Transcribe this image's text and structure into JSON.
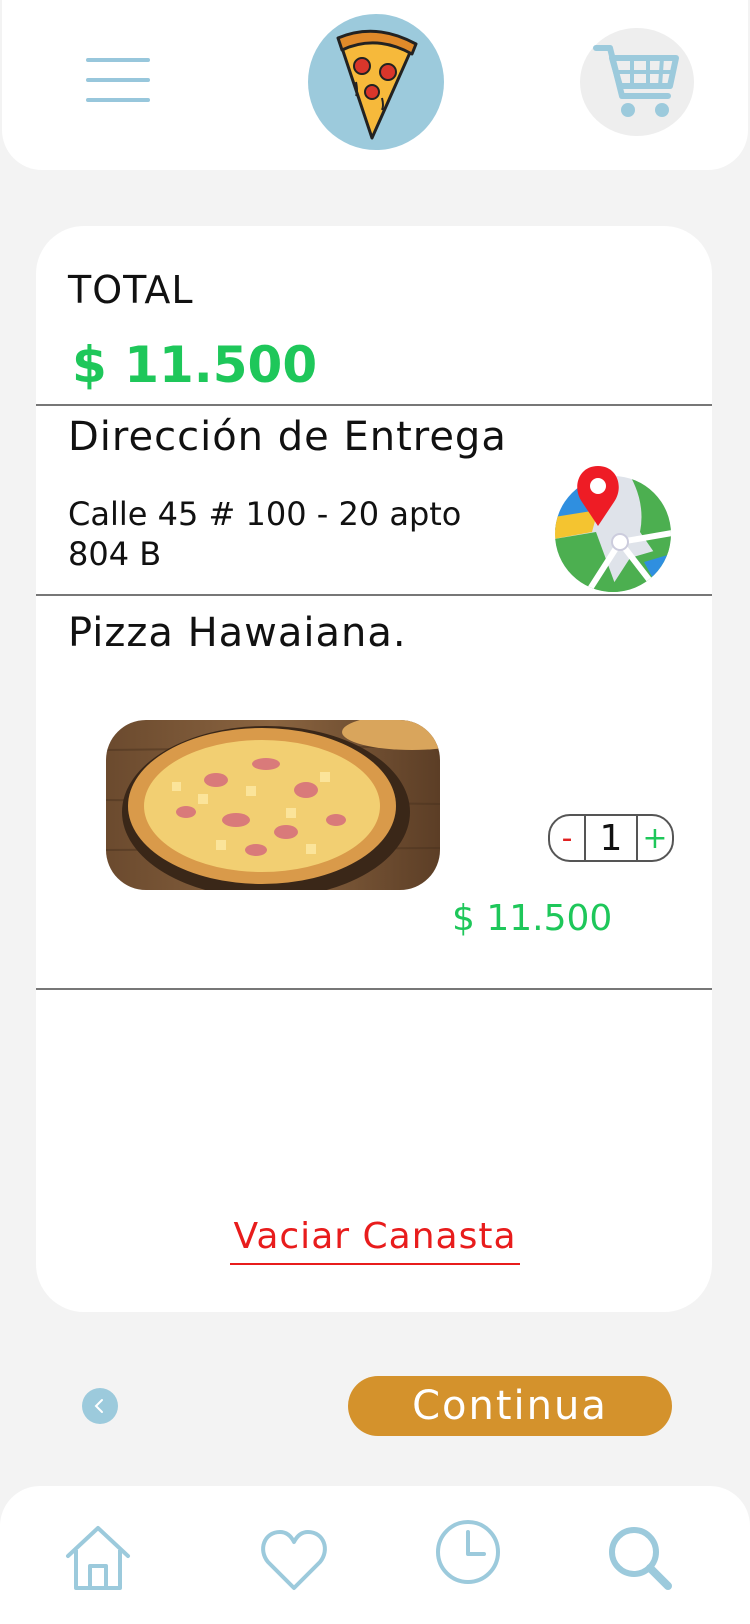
{
  "header": {
    "menu_icon": "hamburger-menu-icon",
    "logo_icon": "pizza-slice-icon",
    "cart_icon": "shopping-cart-icon"
  },
  "cart": {
    "total_label": "TOTAL",
    "total_value": "$ 11.500",
    "delivery_title": "Dirección de Entrega",
    "delivery_address": "Calle 45 # 100 - 20 apto 804 B",
    "map_icon": "map-pin-icon",
    "item": {
      "name": "Pizza Hawaiana.",
      "quantity": "1",
      "minus_label": "-",
      "plus_label": "+",
      "price": "$ 11.500"
    },
    "empty_cart_label": "Vaciar Canasta"
  },
  "actions": {
    "back_icon": "chevron-left-icon",
    "continue_label": "Continua"
  },
  "bottom_nav": {
    "items": [
      {
        "icon": "home-icon"
      },
      {
        "icon": "heart-icon"
      },
      {
        "icon": "clock-icon"
      },
      {
        "icon": "search-icon"
      }
    ]
  },
  "colors": {
    "accent_blue": "#9ccadc",
    "price_green": "#1ec75a",
    "danger_red": "#e81c1c",
    "continue_orange": "#d4922c"
  }
}
